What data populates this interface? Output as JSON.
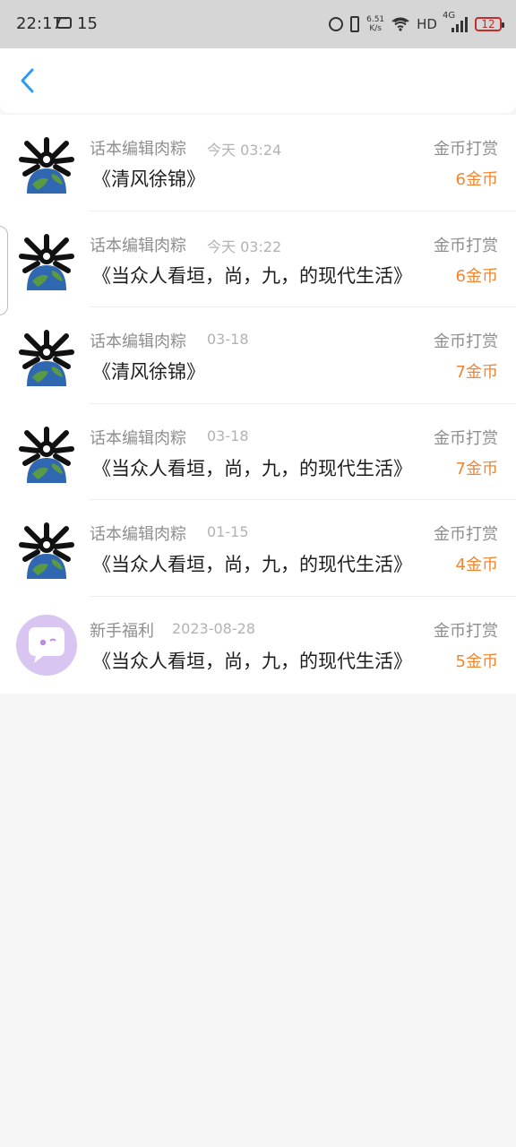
{
  "status_bar": {
    "time": "22:17",
    "message_count": "15",
    "network_speed_value": "6.51",
    "network_speed_unit": "K/s",
    "hd_label": "HD",
    "network_type": "4G",
    "battery_level": "12"
  },
  "nav": {
    "back_icon": "chevron-left-icon",
    "accent_color": "#2d9bf0"
  },
  "colors": {
    "amount": "#f08632",
    "secondary_text": "#8e8e8e",
    "time_text": "#b2b2b2",
    "primary_text": "#1d1d1d"
  },
  "records": [
    {
      "sender": "话本编辑肉粽",
      "time": "今天 03:24",
      "title": "《清风徐锦》",
      "type": "金币打赏",
      "amount": "6金币",
      "avatar": "globe-creature-avatar"
    },
    {
      "sender": "话本编辑肉粽",
      "time": "今天 03:22",
      "title": "《当众人看垣，尚，九，的现代生活》",
      "type": "金币打赏",
      "amount": "6金币",
      "avatar": "globe-creature-avatar"
    },
    {
      "sender": "话本编辑肉粽",
      "time": "03-18",
      "title": "《清风徐锦》",
      "type": "金币打赏",
      "amount": "7金币",
      "avatar": "globe-creature-avatar"
    },
    {
      "sender": "话本编辑肉粽",
      "time": "03-18",
      "title": "《当众人看垣，尚，九，的现代生活》",
      "type": "金币打赏",
      "amount": "7金币",
      "avatar": "globe-creature-avatar"
    },
    {
      "sender": "话本编辑肉粽",
      "time": "01-15",
      "title": "《当众人看垣，尚，九，的现代生活》",
      "type": "金币打赏",
      "amount": "4金币",
      "avatar": "globe-creature-avatar"
    },
    {
      "sender": "新手福利",
      "time": "2023-08-28",
      "title": "《当众人看垣，尚，九，的现代生活》",
      "type": "金币打赏",
      "amount": "5金币",
      "avatar": "chat-bubble-avatar"
    }
  ]
}
